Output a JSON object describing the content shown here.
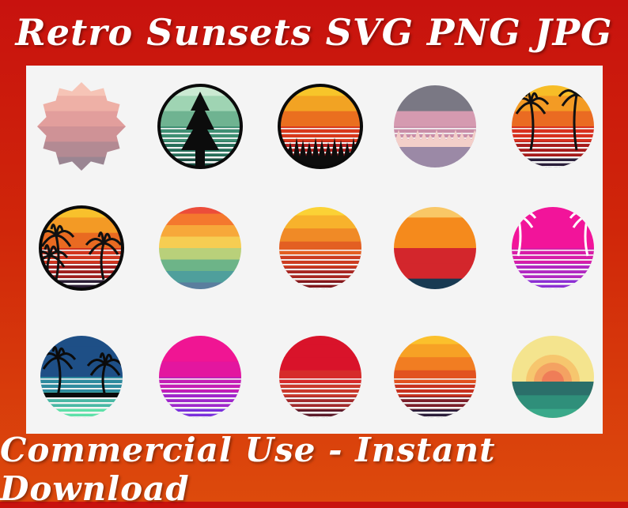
{
  "header": {
    "title": "Retro Sunsets  SVG PNG JPG"
  },
  "footer": {
    "tagline": "Commercial Use  -  Instant Download"
  },
  "colors": {
    "banner_red": "#c8120e",
    "banner_orange": "#dd4a0c",
    "panel": "#f4f4f4"
  },
  "designs": [
    {
      "icon": "pastel-badge-sunset-icon",
      "shape": "badge",
      "bands": [
        "#f6c4b6",
        "#eeb0a6",
        "#e29e9c",
        "#cf9296",
        "#b38a93",
        "#9a8592"
      ],
      "gaps": false,
      "border": false
    },
    {
      "icon": "green-tree-sunset-icon",
      "shape": "circle",
      "bands": [
        "#cbe9d2",
        "#9fd4b3",
        "#6fb391",
        "#3f8f73",
        "#256d58",
        "#1b4f42"
      ],
      "gaps": true,
      "border": true,
      "silhouette": "pine"
    },
    {
      "icon": "forest-sunset-icon",
      "shape": "circle",
      "bands": [
        "#f7c52a",
        "#f2a323",
        "#ea6f1f",
        "#d8381c",
        "#b21e1c",
        "#7d1318"
      ],
      "gaps": true,
      "border": true,
      "silhouette": "forest"
    },
    {
      "icon": "lavender-treeline-sunset-icon",
      "shape": "circle",
      "bands": [
        "#7a7884",
        "#7a7884",
        "#d59ab0",
        "#c98ea8",
        "#b68aa6",
        "#9b89a6"
      ],
      "gaps": true,
      "border": false,
      "silhouette": "treeline"
    },
    {
      "icon": "tropical-palm-sunset-icon",
      "shape": "circle",
      "bands": [
        "#f7bd27",
        "#f39b24",
        "#ea6b22",
        "#d7301f",
        "#a61b1b",
        "#2a1f3a"
      ],
      "gaps": true,
      "border": false,
      "silhouette": "palms-top"
    },
    {
      "icon": "palm-trees-sunset-icon",
      "shape": "circle",
      "bands": [
        "#f8c12c",
        "#f39a25",
        "#e96a21",
        "#d1351e",
        "#9e1d1c",
        "#2d1f36"
      ],
      "gaps": true,
      "border": true,
      "silhouette": "palms"
    },
    {
      "icon": "rainbow-sunset-icon",
      "shape": "circle",
      "bands": [
        "#ec4d3a",
        "#f4782e",
        "#f7a83a",
        "#f6cd52",
        "#b9d07a",
        "#6db488",
        "#4f9f9c",
        "#5a7e9e"
      ],
      "gaps": false,
      "border": false
    },
    {
      "icon": "yellow-red-stripe-sunset-icon",
      "shape": "circle",
      "bands": [
        "#fbd235",
        "#f7b22c",
        "#f08a26",
        "#e35f22",
        "#cc3c20",
        "#a82520",
        "#7e171c"
      ],
      "gaps": true,
      "border": false
    },
    {
      "icon": "orange-navy-sunset-icon",
      "shape": "circle",
      "bands": [
        "#f9c766",
        "#f58a1c",
        "#f58a1c",
        "#d3262c",
        "#d3262c",
        "#183a52"
      ],
      "gaps": false,
      "border": false
    },
    {
      "icon": "magenta-palm-sunset-icon",
      "shape": "circle",
      "bands": [
        "#f2149a",
        "#f2149a",
        "#f2149a",
        "#d81da8",
        "#b127c1",
        "#8c2fd3"
      ],
      "gaps": true,
      "border": false,
      "silhouette": "palms-white"
    },
    {
      "icon": "ocean-palm-sunset-icon",
      "shape": "circle",
      "bands": [
        "#1e4f86",
        "#1e4f86",
        "#1e4f86",
        "#2e8a9e",
        "#47b8a4",
        "#5de0a8"
      ],
      "gaps": true,
      "border": false,
      "silhouette": "palms-beach"
    },
    {
      "icon": "pink-violet-sunset-icon",
      "shape": "circle",
      "bands": [
        "#f01593",
        "#f01593",
        "#e3169f",
        "#c41eb5",
        "#9f26cb",
        "#7a2fdb"
      ],
      "gaps": true,
      "border": false
    },
    {
      "icon": "red-stripe-sunset-icon",
      "shape": "circle",
      "bands": [
        "#d9132a",
        "#d9132a",
        "#d9132a",
        "#d62b2a",
        "#c9392c",
        "#a22a2c",
        "#5c1b2a"
      ],
      "gaps": true,
      "border": false
    },
    {
      "icon": "gold-navy-sunset-icon",
      "shape": "circle",
      "bands": [
        "#fbc02c",
        "#f7a125",
        "#f17d22",
        "#e2521f",
        "#c7321f",
        "#7b1f2a",
        "#2b1e3a"
      ],
      "gaps": true,
      "border": false
    },
    {
      "icon": "concentric-sea-sunset-icon",
      "shape": "rings",
      "bands": [
        "#f4e48e",
        "#f6c66e",
        "#f4a262",
        "#ef7d58",
        "#2b6f6a",
        "#2f8f7a",
        "#3aa98a"
      ],
      "gaps": false,
      "border": false
    }
  ]
}
